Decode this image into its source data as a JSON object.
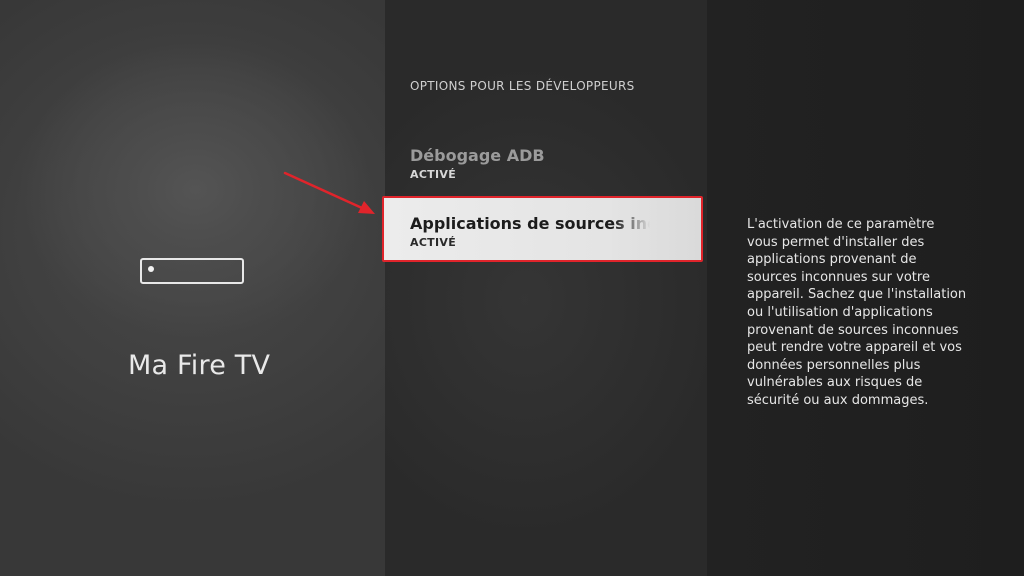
{
  "device": {
    "title": "Ma Fire TV",
    "icon": "fire-tv-stick-icon"
  },
  "section": {
    "header": "OPTIONS POUR LES DÉVELOPPEURS"
  },
  "menu": {
    "items": [
      {
        "label": "Débogage ADB",
        "status": "ACTIVÉ",
        "focused": false
      },
      {
        "label": "Applications de sources inconnues",
        "status": "ACTIVÉ",
        "focused": true
      }
    ]
  },
  "description": {
    "text": "L'activation de ce paramètre vous permet d'installer des applications provenant de sources inconnues sur votre appareil. Sachez que l'installation ou l'utilisation d'applications provenant de sources inconnues peut rendre votre appareil et vos données personnelles plus vulnérables aux risques de sécurité ou aux dommages."
  },
  "colors": {
    "focus_border": "#e0242b",
    "arrow": "#e0242b",
    "focused_background": "#ececec"
  }
}
